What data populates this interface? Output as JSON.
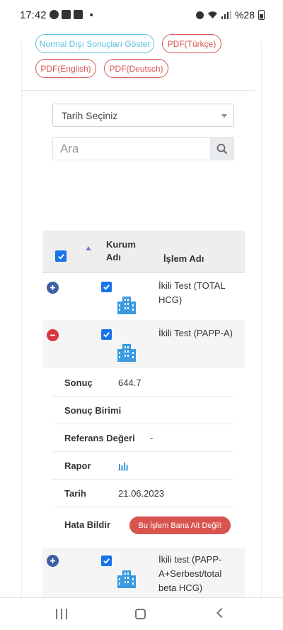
{
  "status_bar": {
    "time": "17:42",
    "battery": "%28"
  },
  "buttons": {
    "abnormal": "Normal Dışı Sonuçları Göster",
    "pdf_tr": "PDF(Türkçe)",
    "pdf_en": "PDF(English)",
    "pdf_de": "PDF(Deutsch)"
  },
  "filter": {
    "date_select": "Tarih Seçiniz",
    "search_placeholder": "Ara"
  },
  "table": {
    "headers": {
      "kurum_line1": "Kurum",
      "kurum_line2": "Adı",
      "islem": "İşlem Adı"
    },
    "rows": [
      {
        "name_line1": "İkili Test (TOTAL",
        "name_line2": "HCG)"
      },
      {
        "name_line1": "İkili Test (PAPP-A)"
      },
      {
        "name_line1": "İkili test (PAPP-",
        "name_line2": "A+Serbest/total",
        "name_line3": "beta HCG)"
      }
    ]
  },
  "details": {
    "result_label": "Sonuç",
    "result_value": "644.7",
    "unit_label": "Sonuç Birimi",
    "reference_label": "Referans Değeri",
    "reference_value": "-",
    "report_label": "Rapor",
    "date_label": "Tarih",
    "date_value": "21.06.2023",
    "report_error_label": "Hata Bildir",
    "not_mine_button": "Bu İşlem Bana Ait Değil!"
  },
  "colors": {
    "info": "#5bc0de",
    "danger": "#d9534f",
    "checkbox": "#1a73e8",
    "expand": "#3c5fa6",
    "building": "#3b9be0"
  },
  "icons": [
    "search-icon",
    "check-icon",
    "building-icon",
    "bar-chart-icon",
    "plus-icon",
    "minus-icon",
    "sort-up-icon"
  ]
}
